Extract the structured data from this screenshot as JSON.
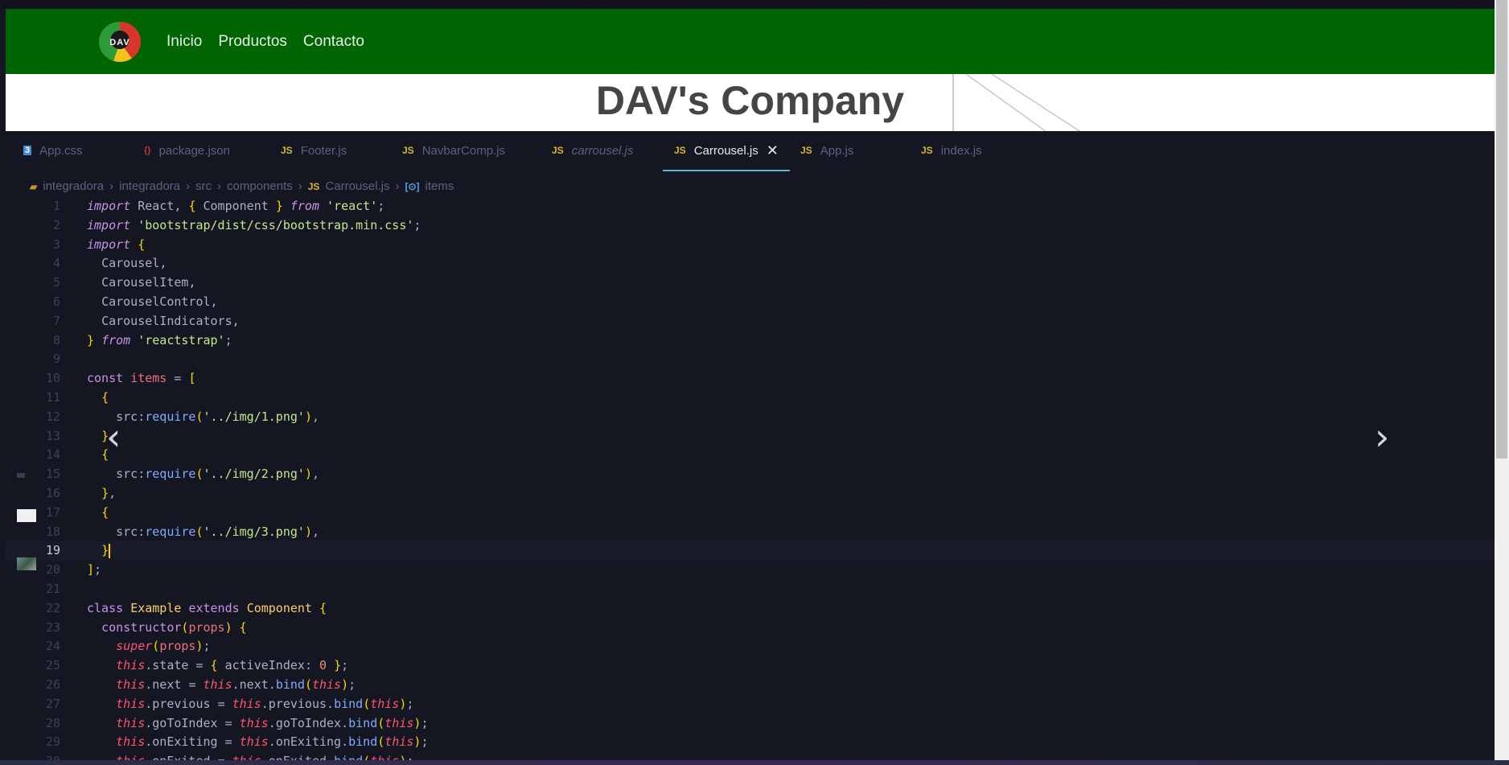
{
  "navbar": {
    "logo_text": "DAV",
    "links": [
      "Inicio",
      "Productos",
      "Contacto"
    ]
  },
  "hero": {
    "title": "DAV's Company"
  },
  "editor": {
    "tabs": [
      {
        "icon": "css-file-icon",
        "icon_text": "3",
        "label": "App.css"
      },
      {
        "icon": "json-file-icon",
        "icon_text": "{}",
        "label": "package.json"
      },
      {
        "icon": "js-file-icon",
        "icon_text": "JS",
        "label": "Footer.js"
      },
      {
        "icon": "js-file-icon",
        "icon_text": "JS",
        "label": "NavbarComp.js"
      },
      {
        "icon": "js-file-icon",
        "icon_text": "JS",
        "label": "carrousel.js"
      },
      {
        "icon": "js-file-icon",
        "icon_text": "JS",
        "label": "Carrousel.js",
        "active": true,
        "close": "✕"
      },
      {
        "icon": "js-file-icon",
        "icon_text": "JS",
        "label": "App.js"
      },
      {
        "icon": "js-file-icon",
        "icon_text": "JS",
        "label": "index.js"
      }
    ],
    "breadcrumb": [
      "integradora",
      "integradora",
      "src",
      "components",
      "Carrousel.js",
      "items"
    ],
    "breadcrumb_icons": {
      "file": "JS",
      "symbol": "[⊙]"
    },
    "current_line": 19,
    "lines": [
      "import React, { Component } from 'react';",
      "import 'bootstrap/dist/css/bootstrap.min.css';",
      "import {",
      "  Carousel,",
      "  CarouselItem,",
      "  CarouselControl,",
      "  CarouselIndicators,",
      "} from 'reactstrap';",
      "",
      "const items = [",
      "  {",
      "    src:require('../img/1.png'),",
      "  },",
      "  {",
      "    src:require('../img/2.png'),",
      "  },",
      "  {",
      "    src:require('../img/3.png'),",
      "  }",
      "];",
      "",
      "class Example extends Component {",
      "  constructor(props) {",
      "    super(props);",
      "    this.state = { activeIndex: 0 };",
      "    this.next = this.next.bind(this);",
      "    this.previous = this.previous.bind(this);",
      "    this.goToIndex = this.goToIndex.bind(this);",
      "    this.onExiting = this.onExiting.bind(this);",
      "    this.onExited = this.onExited.bind(this);"
    ]
  },
  "carousel": {
    "prev_icon": "‹",
    "next_icon": "›"
  }
}
